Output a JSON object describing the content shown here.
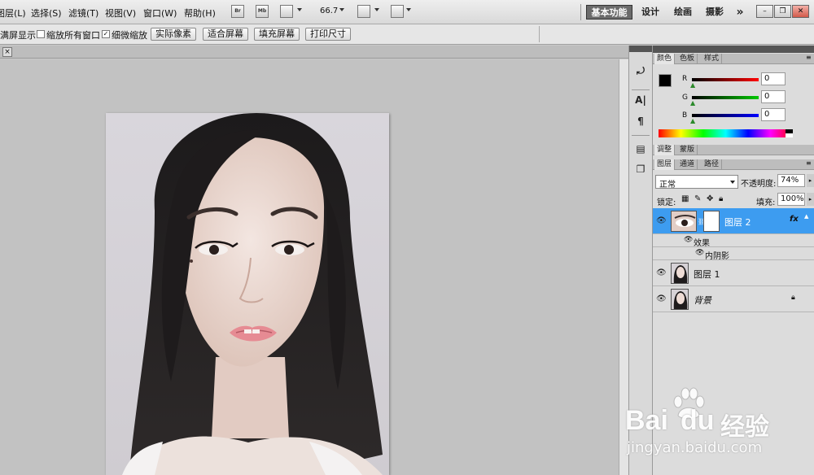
{
  "menubar": {
    "items": [
      "图层(L)",
      "选择(S)",
      "滤镜(T)",
      "视图(V)",
      "窗口(W)",
      "帮助(H)"
    ],
    "bridge_label": "Br",
    "minibridge_label": "Mb",
    "zoom": "66.7",
    "workspaces": [
      "基本功能",
      "设计",
      "绘画",
      "摄影"
    ],
    "more": "»"
  },
  "options": {
    "fullscreen_label": "满屏显示",
    "zoom_all_windows": "缩放所有窗口",
    "zoom_all_checked": false,
    "scrubby_zoom": "细微缩放",
    "scrubby_checked": true,
    "buttons": [
      "实际像素",
      "适合屏幕",
      "填充屏幕",
      "打印尺寸"
    ]
  },
  "doc": {
    "close_glyph": "×"
  },
  "color_panel": {
    "tabs": [
      "颜色",
      "色板",
      "样式"
    ],
    "channels": [
      {
        "label": "R",
        "value": "0"
      },
      {
        "label": "G",
        "value": "0"
      },
      {
        "label": "B",
        "value": "0"
      }
    ],
    "fg_color": "#000000",
    "bg_color": "#ffffff"
  },
  "adjust_panel": {
    "tabs": [
      "调整",
      "蒙版"
    ]
  },
  "layers_panel": {
    "tabs": [
      "图层",
      "通道",
      "路径"
    ],
    "blend_mode": "正常",
    "opacity_label": "不透明度:",
    "opacity": "74%",
    "lock_label": "锁定:",
    "fill_label": "填充:",
    "fill": "100%",
    "layers": [
      {
        "name": "图层 2",
        "selected": true,
        "fx": "fx"
      },
      {
        "name": "效果",
        "kind": "effect-group"
      },
      {
        "name": "内阴影",
        "kind": "effect"
      },
      {
        "name": "图层 1",
        "selected": false
      },
      {
        "name": "背景",
        "selected": false,
        "locked": true
      }
    ]
  },
  "watermark": {
    "brand": "Bai",
    "brand2": "du",
    "service": "经验",
    "url": "jingyan.baidu.com"
  },
  "colors": {
    "accent": "#3c8ee4",
    "selected_row": "#3d9cf0"
  }
}
